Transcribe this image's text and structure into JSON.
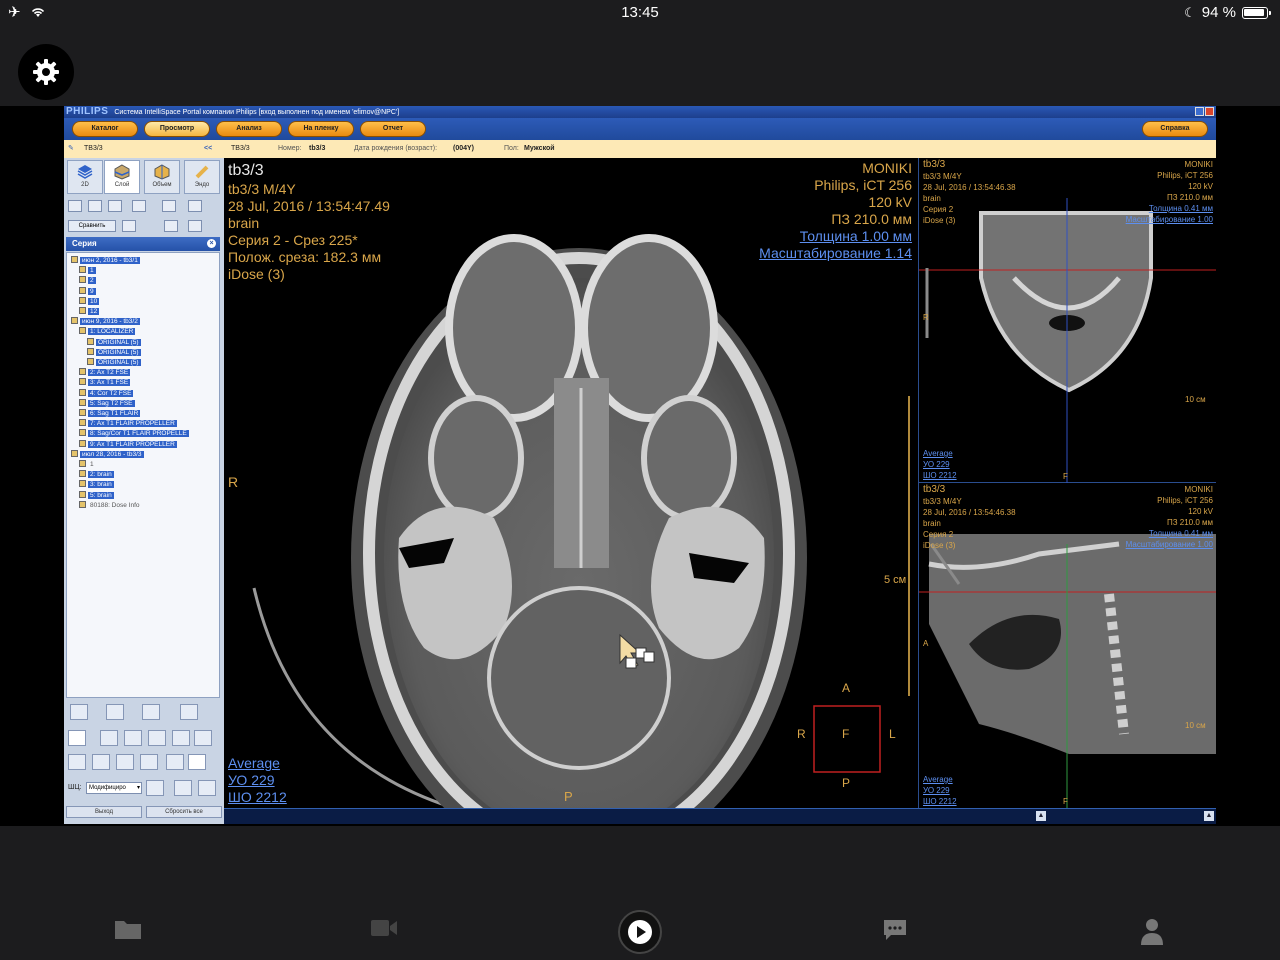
{
  "status_bar": {
    "time": "13:45",
    "battery_text": "94 %",
    "battery_level": 0.94
  },
  "app": {
    "brand": "PHILIPS",
    "title": "Система IntelliSpace Portal компании Philips [вход выполнен под именем 'efimov@NPC']",
    "menu": [
      "Каталог",
      "Просмотр",
      "Анализ",
      "На пленку",
      "Отчет"
    ],
    "help": "Справка",
    "active_menu": "Просмотр"
  },
  "patient_bar": {
    "case_id": "TB3/3",
    "collapse": "<<",
    "case_id2": "TB3/3",
    "number_label": "Номер:",
    "number_value": "tb3/3",
    "dob_label": "Дата рождения (возраст):",
    "dob_value": "(004Y)",
    "sex_label": "Пол:",
    "sex_value": "Мужской"
  },
  "side_panel": {
    "tabs": [
      "2D",
      "Слой",
      "Объем",
      "Эндо"
    ],
    "compare_btn": "Сравнить",
    "series_title": "Серия",
    "tree": [
      {
        "label": "июн 2, 2016 - tb3/1",
        "depth": 0,
        "selected": true
      },
      {
        "label": "1",
        "depth": 1,
        "selected": true
      },
      {
        "label": "2",
        "depth": 1,
        "selected": true
      },
      {
        "label": "9",
        "depth": 1,
        "selected": true
      },
      {
        "label": "10",
        "depth": 1,
        "selected": true
      },
      {
        "label": "12",
        "depth": 1,
        "selected": true
      },
      {
        "label": "июн 9, 2016 - tb3/2",
        "depth": 0,
        "selected": true
      },
      {
        "label": "1: LOCALIZER",
        "depth": 1,
        "selected": true
      },
      {
        "label": "ORIGINAL (5)",
        "depth": 2,
        "selected": true
      },
      {
        "label": "ORIGINAL (5)",
        "depth": 2,
        "selected": true
      },
      {
        "label": "ORIGINAL (5)",
        "depth": 2,
        "selected": true
      },
      {
        "label": "2: Ax T2 FSE",
        "depth": 1,
        "selected": true
      },
      {
        "label": "3: Ax T1 FSE",
        "depth": 1,
        "selected": true
      },
      {
        "label": "4: Cor T2 FSE",
        "depth": 1,
        "selected": true
      },
      {
        "label": "5: Sag T2 FSE",
        "depth": 1,
        "selected": true
      },
      {
        "label": "6: Sag T1 FLAIR",
        "depth": 1,
        "selected": true
      },
      {
        "label": "7: Ax T1 FLAIR PROPELLER",
        "depth": 1,
        "selected": true
      },
      {
        "label": "8: Sag/Cor T1 FLAIR PROPELLE",
        "depth": 1,
        "selected": true
      },
      {
        "label": "9: Ax T1 FLAIR PROPELLER",
        "depth": 1,
        "selected": true
      },
      {
        "label": "июл 28, 2016 - tb3/3",
        "depth": 0,
        "selected": true
      },
      {
        "label": "1",
        "depth": 1,
        "selected": false
      },
      {
        "label": "2: brain",
        "depth": 1,
        "selected": true
      },
      {
        "label": "3: brain",
        "depth": 1,
        "selected": true
      },
      {
        "label": "5: brain",
        "depth": 1,
        "selected": true
      },
      {
        "label": "80188: Dose Info",
        "depth": 1,
        "selected": false
      }
    ],
    "wl_label": "ШЦ:",
    "wl_select": "Модифициро",
    "exit_btn": "Выход",
    "reset_btn": "Сбросить все"
  },
  "main_view": {
    "tl": [
      "tb3/3",
      "tb3/3 M/4Y",
      "28 Jul, 2016 / 13:54:47.49",
      "brain",
      "Серия 2 - Срез 225*",
      "Полож. среза: 182.3 мм",
      "iDose (3)"
    ],
    "tr": [
      "MONIKI",
      "Philips, iCT 256",
      "120 kV",
      "ПЗ 210.0 мм"
    ],
    "tr_links": [
      "Толщина 1.00 мм",
      "Масштабирование 1.14"
    ],
    "bl": [
      "Average",
      "УО   229",
      "ШО  2212"
    ],
    "scale": "5 см",
    "orient": {
      "left": "R",
      "bottom": "P",
      "cube_top": "A",
      "cube_left": "R",
      "cube_center": "F",
      "cube_right": "L",
      "cube_bottom": "P"
    }
  },
  "coronal_view": {
    "tl": [
      "tb3/3",
      "tb3/3 M/4Y",
      "28 Jul, 2016 / 13:54:46.38",
      "brain",
      "Серия 2",
      "iDose (3)"
    ],
    "tr": [
      "MONIKI",
      "Philips, iCT 256",
      "120 kV",
      "ПЗ 210.0 мм"
    ],
    "tr_links": [
      "Толщина 0.41 мм",
      "Масштабирование 1.00"
    ],
    "bl": [
      "Average",
      "УО   229",
      "ШО  2212"
    ],
    "scale": "10 см",
    "orient": {
      "left": "R",
      "bottom": "F"
    }
  },
  "sagittal_view": {
    "tl": [
      "tb3/3",
      "tb3/3 M/4Y",
      "28 Jul, 2016 / 13:54:46.38",
      "brain",
      "Серия 2",
      "iDose (3)"
    ],
    "tr": [
      "MONIKI",
      "Philips, iCT 256",
      "120 kV",
      "ПЗ 210.0 мм"
    ],
    "tr_links": [
      "Толщина 0.41 мм",
      "Масштабирование 1.00"
    ],
    "bl": [
      "Average",
      "УО   229",
      "ШО  2212"
    ],
    "scale": "10 см",
    "orient": {
      "left": "A",
      "bottom": "F"
    }
  },
  "bottom_nav": {
    "icons": [
      "folder-icon",
      "video-camera-icon",
      "play-icon",
      "chat-icon",
      "person-icon"
    ]
  }
}
